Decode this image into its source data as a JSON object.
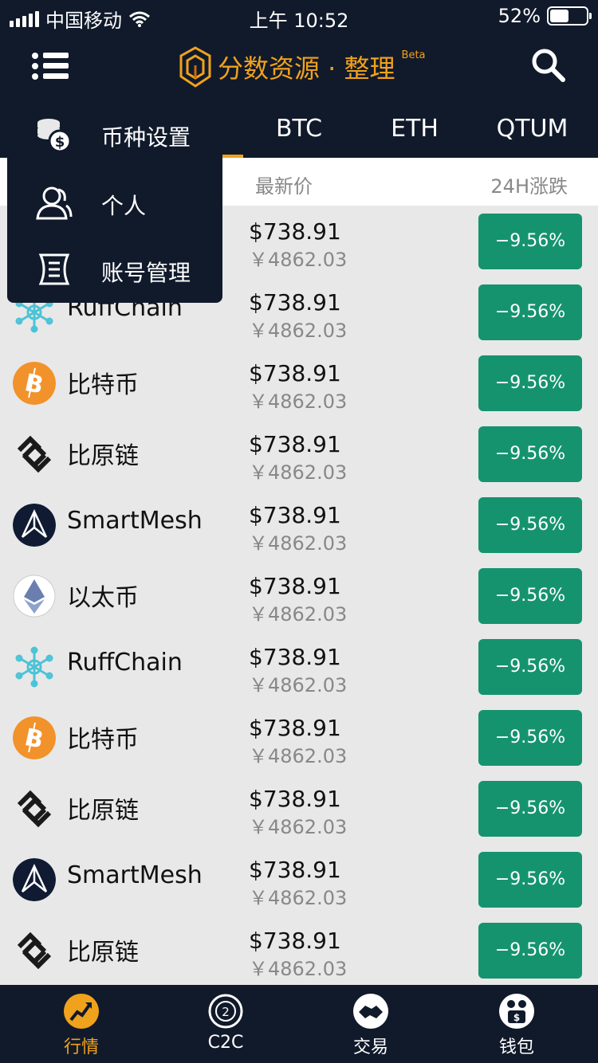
{
  "status_bar": {
    "carrier": "中国移动",
    "time": "上午 10:52",
    "battery": "52%",
    "battery_level": 0.52
  },
  "header": {
    "title": "分数资源 · 整理",
    "beta": "Beta"
  },
  "tabs": [
    {
      "label": "BTC"
    },
    {
      "label": "ETH"
    },
    {
      "label": "QTUM"
    }
  ],
  "columns": {
    "price": "最新价",
    "change": "24H涨跌"
  },
  "dropdown": [
    {
      "label": "币种设置",
      "icon": "coins-icon"
    },
    {
      "label": "个人",
      "icon": "user-icon"
    },
    {
      "label": "账号管理",
      "icon": "scroll-icon"
    }
  ],
  "rows": [
    {
      "name": "",
      "icon": "hidden",
      "usd": "$738.91",
      "cny": "￥4862.03",
      "change": "−9.56%"
    },
    {
      "name": "RuffChain",
      "icon": "ruffchain",
      "usd": "$738.91",
      "cny": "￥4862.03",
      "change": "−9.56%"
    },
    {
      "name": "比特币",
      "icon": "bitcoin",
      "usd": "$738.91",
      "cny": "￥4862.03",
      "change": "−9.56%"
    },
    {
      "name": "比原链",
      "icon": "bytom",
      "usd": "$738.91",
      "cny": "￥4862.03",
      "change": "−9.56%"
    },
    {
      "name": "SmartMesh",
      "icon": "smartmesh",
      "usd": "$738.91",
      "cny": "￥4862.03",
      "change": "−9.56%"
    },
    {
      "name": "以太币",
      "icon": "ethereum",
      "usd": "$738.91",
      "cny": "￥4862.03",
      "change": "−9.56%"
    },
    {
      "name": "RuffChain",
      "icon": "ruffchain",
      "usd": "$738.91",
      "cny": "￥4862.03",
      "change": "−9.56%"
    },
    {
      "name": "比特币",
      "icon": "bitcoin",
      "usd": "$738.91",
      "cny": "￥4862.03",
      "change": "−9.56%"
    },
    {
      "name": "比原链",
      "icon": "bytom",
      "usd": "$738.91",
      "cny": "￥4862.03",
      "change": "−9.56%"
    },
    {
      "name": "SmartMesh",
      "icon": "smartmesh",
      "usd": "$738.91",
      "cny": "￥4862.03",
      "change": "−9.56%"
    },
    {
      "name": "比原链",
      "icon": "bytom",
      "usd": "$738.91",
      "cny": "￥4862.03",
      "change": "−9.56%"
    }
  ],
  "bottom_nav": [
    {
      "label": "行情",
      "icon": "market-icon",
      "active": true
    },
    {
      "label": "C2C",
      "icon": "c2c-icon",
      "active": false
    },
    {
      "label": "交易",
      "icon": "trade-icon",
      "active": false
    },
    {
      "label": "钱包",
      "icon": "wallet-icon",
      "active": false
    }
  ],
  "colors": {
    "navy": "#111a2b",
    "accent": "#f0a21c",
    "badge": "#15936f"
  }
}
